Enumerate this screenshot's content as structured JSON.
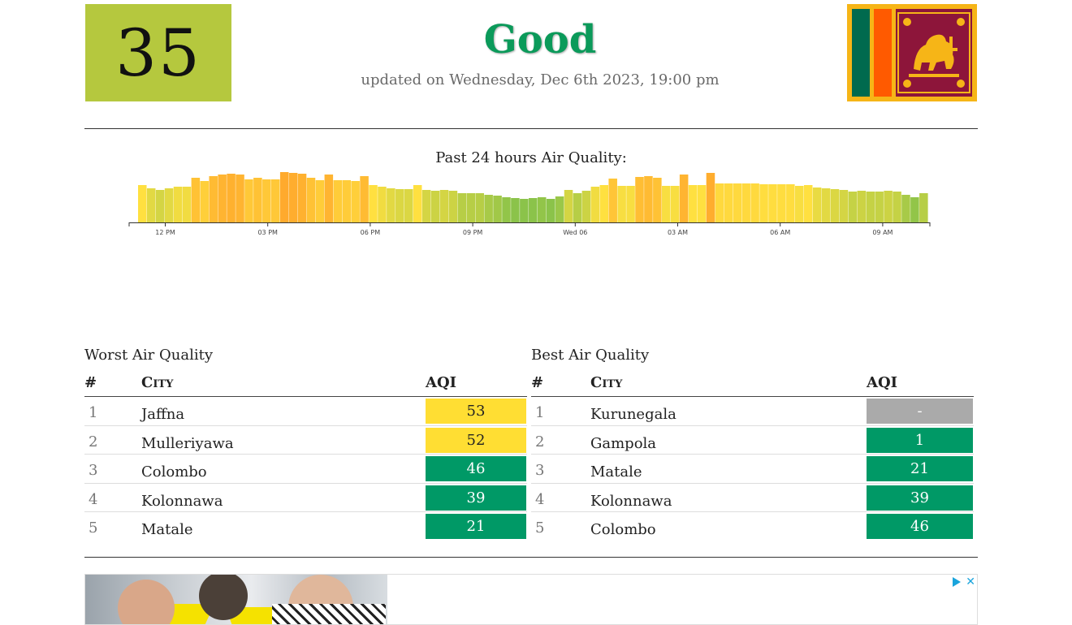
{
  "colors": {
    "good": "#009966",
    "moderate": "#ffde33",
    "no_data": "#aaaaaa",
    "current_box": "#b5c83e",
    "status_text": "#0b9a5a"
  },
  "current": {
    "aqi": "35",
    "status": "Good",
    "updated": "updated on Wednesday, Dec 6th 2023, 19:00 pm"
  },
  "flag": {
    "country_icon": "sri-lanka-flag-icon"
  },
  "chart_data": {
    "type": "bar",
    "title": "Past 24 hours Air Quality:",
    "tick_labels": [
      "12 PM",
      "03 PM",
      "06 PM",
      "09 PM",
      "Wed 06",
      "03 AM",
      "06 AM",
      "09 AM"
    ],
    "values": [
      46,
      42,
      40,
      42,
      44,
      44,
      55,
      51,
      57,
      59,
      60,
      59,
      53,
      55,
      53,
      53,
      62,
      61,
      60,
      55,
      52,
      59,
      52,
      52,
      51,
      57,
      46,
      44,
      42,
      41,
      41,
      46,
      40,
      39,
      40,
      39,
      36,
      36,
      36,
      34,
      33,
      31,
      30,
      29,
      30,
      31,
      29,
      32,
      40,
      36,
      39,
      44,
      46,
      54,
      45,
      45,
      56,
      57,
      55,
      45,
      45,
      59,
      46,
      46,
      61,
      48,
      48,
      48,
      48,
      48,
      47,
      47,
      47,
      47,
      45,
      46,
      43,
      42,
      41,
      40,
      38,
      39,
      38,
      38,
      39,
      38,
      34,
      31,
      36
    ]
  },
  "worst": {
    "title": "Worst Air Quality",
    "col_rank": "#",
    "col_city": "City",
    "col_aqi": "AQI",
    "rows": [
      {
        "rank": "1",
        "city": "Jaffna",
        "aqi": "53",
        "level": "moderate"
      },
      {
        "rank": "2",
        "city": "Mulleriyawa",
        "aqi": "52",
        "level": "moderate"
      },
      {
        "rank": "3",
        "city": "Colombo",
        "aqi": "46",
        "level": "good"
      },
      {
        "rank": "4",
        "city": "Kolonnawa",
        "aqi": "39",
        "level": "good"
      },
      {
        "rank": "5",
        "city": "Matale",
        "aqi": "21",
        "level": "good"
      }
    ]
  },
  "best": {
    "title": "Best Air Quality",
    "col_rank": "#",
    "col_city": "City",
    "col_aqi": "AQI",
    "rows": [
      {
        "rank": "1",
        "city": "Kurunegala",
        "aqi": "-",
        "level": "no_data"
      },
      {
        "rank": "2",
        "city": "Gampola",
        "aqi": "1",
        "level": "good"
      },
      {
        "rank": "3",
        "city": "Matale",
        "aqi": "21",
        "level": "good"
      },
      {
        "rank": "4",
        "city": "Kolonnawa",
        "aqi": "39",
        "level": "good"
      },
      {
        "rank": "5",
        "city": "Colombo",
        "aqi": "46",
        "level": "good"
      }
    ]
  },
  "ad": {
    "image_icon": "advertisement-image",
    "adchoices_icon": "adchoices-icon",
    "close_icon": "close-icon"
  }
}
